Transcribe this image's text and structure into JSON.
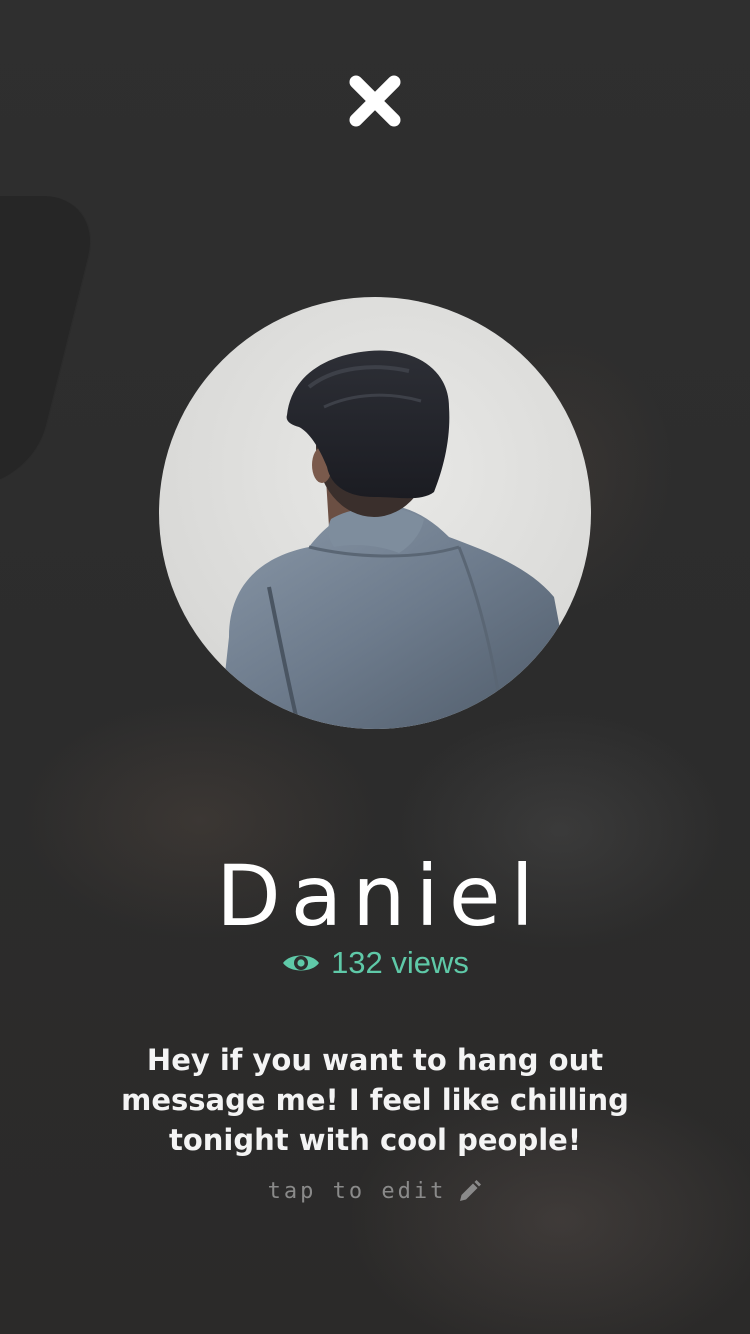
{
  "profile": {
    "name": "Daniel",
    "views_label": "132 views",
    "bio": "Hey if you want to hang out message me! I feel like chilling tonight with cool people!",
    "edit_hint": "tap to edit"
  },
  "icons": {
    "close": "close-icon",
    "views": "eye-icon",
    "edit": "pencil-icon"
  },
  "colors": {
    "background": "#2e2e2e",
    "accent": "#5fc9a8",
    "text": "#ffffff",
    "muted": "#8a8a8a"
  }
}
